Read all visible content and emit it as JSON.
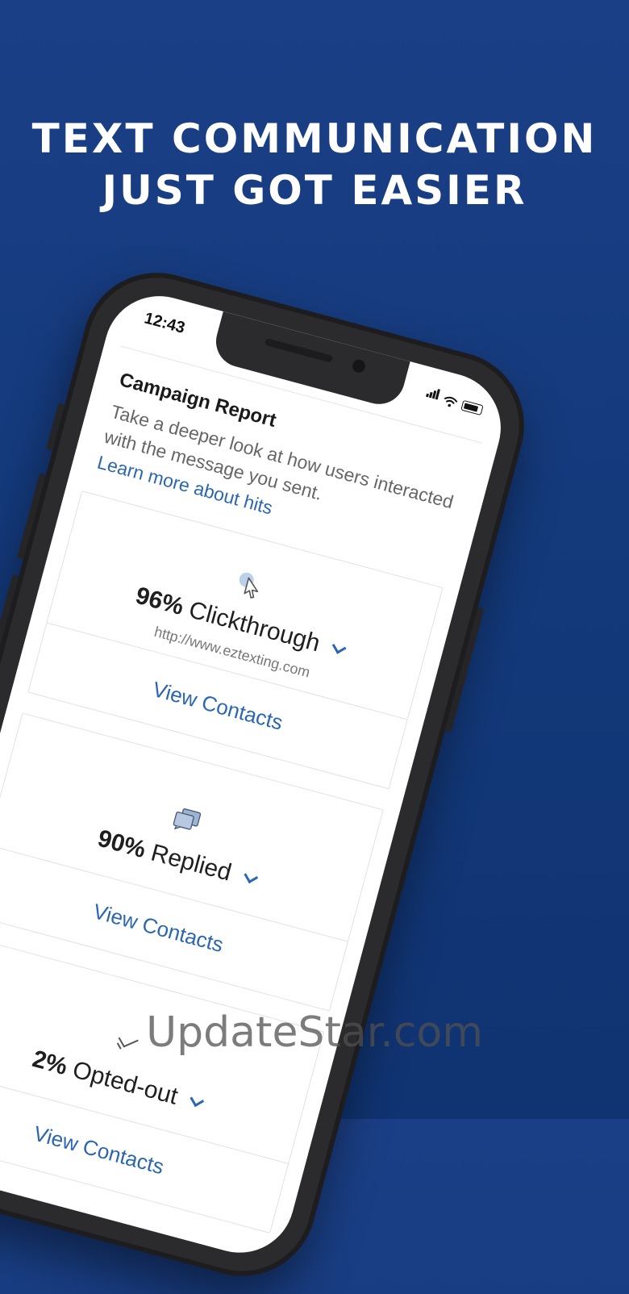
{
  "headline": {
    "line1": "TEXT COMMUNICATION",
    "line2": "JUST GOT EASIER"
  },
  "status_bar": {
    "time": "12:43",
    "icons": [
      "signal-icon",
      "wifi-icon",
      "battery-icon"
    ]
  },
  "report": {
    "title": "Campaign Report",
    "description": "Take a deeper look at how users interacted with the message you sent.",
    "learn_more": "Learn more about hits"
  },
  "metrics": [
    {
      "icon": "cursor-click-icon",
      "percent": "96%",
      "label": "Clickthrough",
      "url": "http://www.eztexting.com",
      "action": "View Contacts"
    },
    {
      "icon": "chat-bubbles-icon",
      "percent": "90%",
      "label": "Replied",
      "action": "View Contacts"
    },
    {
      "icon": "opt-out-check-icon",
      "percent": "2%",
      "label": "Opted-out",
      "action": "View Contacts"
    }
  ],
  "watermark": "UpdateStar.com",
  "colors": {
    "background": "#153a7d",
    "accent": "#2a66b3",
    "phone_frame": "#2b2b2e"
  }
}
